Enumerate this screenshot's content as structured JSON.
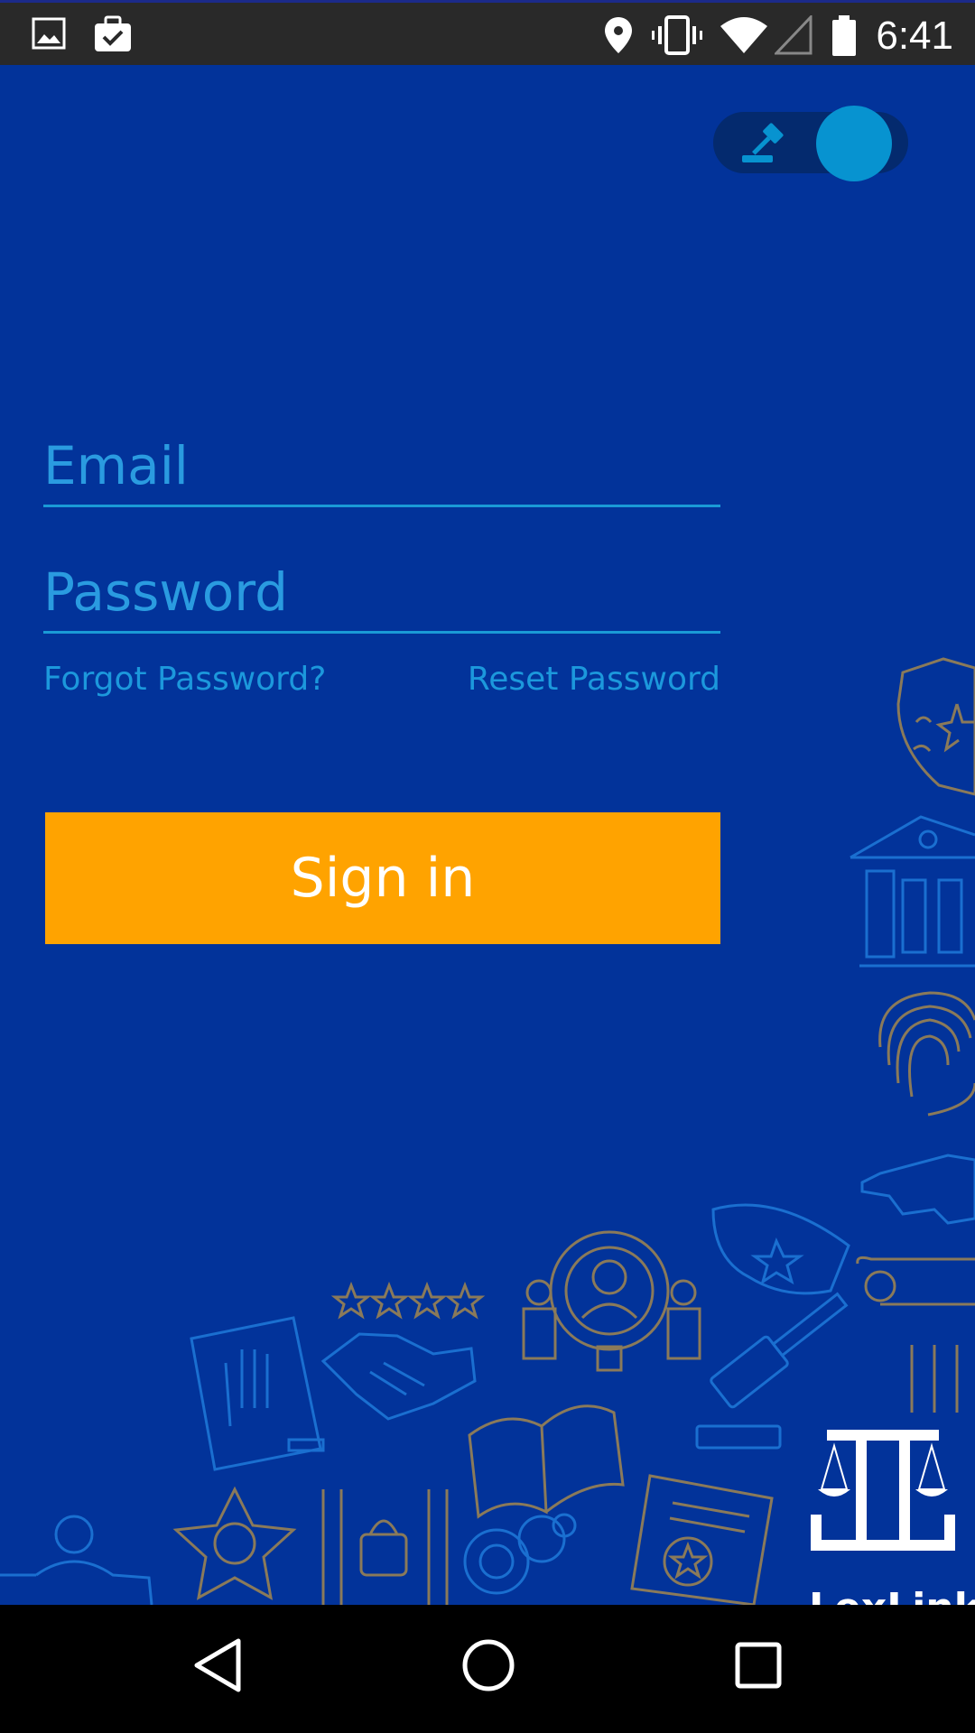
{
  "status_bar": {
    "time": "6:41",
    "icons": [
      "gallery-icon",
      "briefcase-check-icon",
      "location-icon",
      "vibrate-icon",
      "wifi-icon",
      "cell-signal-icon",
      "battery-icon"
    ]
  },
  "toggle": {
    "icon": "gavel-icon",
    "state": "on"
  },
  "login": {
    "email_placeholder": "Email",
    "password_placeholder": "Password",
    "forgot_password": "Forgot Password?",
    "reset_password": "Reset Password",
    "sign_in": "Sign in"
  },
  "logo": {
    "text": "LexLink"
  },
  "nav_bar": {
    "buttons": [
      "back-icon",
      "home-icon",
      "recents-icon"
    ]
  },
  "colors": {
    "background": "#02339a",
    "accent": "#1c98dc",
    "button": "#ffa300",
    "toggle_knob": "#0793d0"
  }
}
